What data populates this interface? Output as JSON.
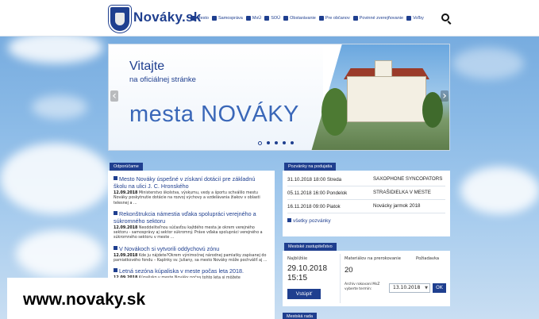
{
  "site": {
    "logo_text": "Nováky.sk",
    "nav": [
      {
        "label": "Mesto"
      },
      {
        "label": "Samospráva"
      },
      {
        "label": "MsÚ"
      },
      {
        "label": "SOÚ"
      },
      {
        "label": "Obstarávanie"
      },
      {
        "label": "Pre občanov"
      },
      {
        "label": "Povinné zverejňovanie"
      },
      {
        "label": "Voľby"
      }
    ],
    "search_icon": "search-icon"
  },
  "hero": {
    "welcome": "Vitajte",
    "subtitle": "na oficiálnej stránke",
    "title": "mesta NOVÁKY",
    "slides_total": 5,
    "active_slide": 1
  },
  "news": {
    "header": "Odporúčame",
    "items": [
      {
        "title": "Mesto Nováky úspešné v získaní dotácií pre základnú školu na ulici J. C. Hronského",
        "date": "12.09.2018",
        "body": "Ministerstvo školstva, výskumu, vedy a športu schválilo mestu Nováky poskytnutie dotácie na rozvoj výchovy a vzdelávania žiakov v oblasti telesnej a ..."
      },
      {
        "title": "Rekonštrukcia námestia vďaka spolupráci verejného a súkromného sektoru",
        "date": "12.09.2018",
        "body": "Neoddeliteľnou súčasťou každého mesta je okrem verejného sektoru - samosprávy aj sektor súkromný. Práve vďaka spolupráci verejného a súkromného sektoru v meste ..."
      },
      {
        "title": "V Novákoch si vytvorili oddychovú zónu",
        "date": "12.09.2018",
        "body": "Kde ju nájdete?Okrem výnimočnej národnej pamiatky zapísanej do pamiatkového fondu – Kaplnky sv. Juliany, sa mesto Nováky môže pochváliť aj ..."
      },
      {
        "title": "Letná sezóna kúpaliska v meste počas leta 2018.",
        "date": "12.09.2018",
        "body": "Kúpalisko v meste Nováky počas tohto leta si môžete"
      }
    ]
  },
  "events": {
    "header": "Pozvánky na podujatia",
    "rows": [
      {
        "datetime": "31.10.2018 18:00 Streda",
        "name": "SAXOPHONE SYNCOPATORS"
      },
      {
        "datetime": "05.11.2018 16:00 Pondelok",
        "name": "STRAŠIDIELKA V MESTE"
      },
      {
        "datetime": "16.11.2018 09:00 Piatok",
        "name": "Novácky jarmok 2018"
      }
    ],
    "all_link": "všetky pozvánky"
  },
  "council": {
    "header": "Mestské zastupiteľstvo",
    "next_label": "Najbližšie",
    "next_date": "29.10.2018",
    "next_time": "15:15",
    "enter_button": "Vstúpiť",
    "materials_label": "Materiálov na prerokovanie",
    "materials_count": "20",
    "requests_label": "Požiadavka",
    "archive_label": "Archív rokovaní MsZ vyberte termín:",
    "archive_selected": "13.10.2018",
    "ok_button": "OK"
  },
  "footer_header": "Mestská rada",
  "watermark": "www.novaky.sk",
  "colors": {
    "brand": "#1f3f8f",
    "accent": "#3a67b8",
    "sky": "#8cbbe7"
  }
}
